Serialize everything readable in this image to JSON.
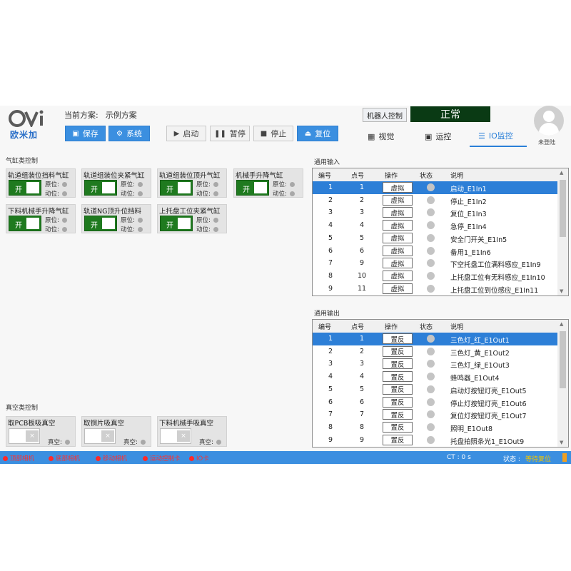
{
  "header": {
    "logo_text": "欧米加",
    "scheme_label": "当前方案:",
    "scheme_value": "示例方案",
    "buttons": {
      "save": "保存",
      "system": "系统",
      "start": "启动",
      "pause": "暂停",
      "stop": "停止",
      "reset": "复位"
    },
    "robot_control": "机器人控制",
    "status": "正常",
    "tabs": {
      "vision": "视觉",
      "motion": "运控",
      "io": "IO监控"
    },
    "user": "未登陆"
  },
  "cylinders": {
    "title": "气缸类控制",
    "on_label": "开",
    "origin_label": "原位:",
    "action_label": "动位:",
    "items": [
      "轨道组装位挡料气缸",
      "轨道组装位夹紧气缸",
      "轨道组装位顶升气缸",
      "机械手升降气缸",
      "下料机械手升降气缸",
      "轨道NG顶升位挡料",
      "上托盘工位夹紧气缸"
    ]
  },
  "vacuum": {
    "title": "真空类控制",
    "status_label": "真空:",
    "items": [
      "取PCB板吸真空",
      "取铜片吸真空",
      "下料机械手吸真空"
    ]
  },
  "io_input": {
    "title": "通用输入",
    "headers": [
      "编号",
      "点号",
      "操作",
      "状态",
      "说明"
    ],
    "rows": [
      {
        "no": "1",
        "pt": "1",
        "op": "虚拟",
        "desc": "启动_E1In1"
      },
      {
        "no": "2",
        "pt": "2",
        "op": "虚拟",
        "desc": "停止_E1In2"
      },
      {
        "no": "3",
        "pt": "3",
        "op": "虚拟",
        "desc": "复位_E1In3"
      },
      {
        "no": "4",
        "pt": "4",
        "op": "虚拟",
        "desc": "急停_E1In4"
      },
      {
        "no": "5",
        "pt": "5",
        "op": "虚拟",
        "desc": "安全门开关_E1In5"
      },
      {
        "no": "6",
        "pt": "6",
        "op": "虚拟",
        "desc": "备用1_E1In6"
      },
      {
        "no": "7",
        "pt": "9",
        "op": "虚拟",
        "desc": "下空托盘工位满料感应_E1In9"
      },
      {
        "no": "8",
        "pt": "10",
        "op": "虚拟",
        "desc": "上托盘工位有无料感应_E1In10"
      },
      {
        "no": "9",
        "pt": "11",
        "op": "虚拟",
        "desc": "上托盘工位到位感应_E1In11"
      }
    ]
  },
  "io_output": {
    "title": "通用输出",
    "headers": [
      "编号",
      "点号",
      "操作",
      "状态",
      "说明"
    ],
    "rows": [
      {
        "no": "1",
        "pt": "1",
        "op": "置反",
        "desc": "三色灯_红_E1Out1"
      },
      {
        "no": "2",
        "pt": "2",
        "op": "置反",
        "desc": "三色灯_黄_E1Out2"
      },
      {
        "no": "3",
        "pt": "3",
        "op": "置反",
        "desc": "三色灯_绿_E1Out3"
      },
      {
        "no": "4",
        "pt": "4",
        "op": "置反",
        "desc": "蜂鸣器_E1Out4"
      },
      {
        "no": "5",
        "pt": "5",
        "op": "置反",
        "desc": "启动灯按钮灯亮_E1Out5"
      },
      {
        "no": "6",
        "pt": "6",
        "op": "置反",
        "desc": "停止灯按钮灯亮_E1Out6"
      },
      {
        "no": "7",
        "pt": "7",
        "op": "置反",
        "desc": "复位灯按钮灯亮_E1Out7"
      },
      {
        "no": "8",
        "pt": "8",
        "op": "置反",
        "desc": "照明_E1Out8"
      },
      {
        "no": "9",
        "pt": "9",
        "op": "置反",
        "desc": "托盘拍照条光1_E1Out9"
      }
    ]
  },
  "statusbar": {
    "items": [
      "顶部相机",
      "底部相机",
      "移动相机",
      "运动控制卡",
      "IO卡"
    ],
    "ct": "CT : 0 s",
    "state_label": "状态 :",
    "state_value": "等待复位"
  },
  "colors": {
    "accent": "#3b8fe0",
    "status_bg": "#0a3a14",
    "toggle_on": "#1f7a1f",
    "selected_row": "#2d7fd7",
    "alert": "#ff2a2a"
  }
}
